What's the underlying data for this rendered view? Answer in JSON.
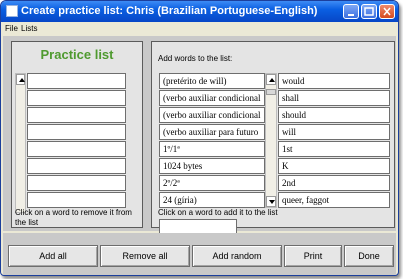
{
  "window": {
    "title": "Create practice list: Chris (Brazilian Portuguese-English)"
  },
  "menu": {
    "items": [
      "File",
      "Lists"
    ]
  },
  "practice": {
    "title": "Practice list",
    "items": [
      "",
      "",
      "",
      "",
      "",
      "",
      "",
      "",
      ""
    ],
    "hint": "Click on a word to remove it from the list"
  },
  "add": {
    "heading": "Add words to the list:",
    "rows": [
      {
        "source": "(pretérito de will)",
        "target": "would"
      },
      {
        "source": "(verbo auxiliar condicional",
        "target": "shall"
      },
      {
        "source": "(verbo auxiliar condicional",
        "target": "should"
      },
      {
        "source": "(verbo auxiliar para futuro",
        "target": "will"
      },
      {
        "source": "1º/1ª",
        "target": "1st"
      },
      {
        "source": "1024 bytes",
        "target": "K"
      },
      {
        "source": "2º/2ª",
        "target": "2nd"
      },
      {
        "source": "24 (gíria)",
        "target": "queer, faggot"
      }
    ],
    "hint": "Click on a word to add it to the list",
    "input_value": ""
  },
  "buttons": {
    "add_all": "Add all",
    "remove_all": "Remove all",
    "add_random": "Add random",
    "print": "Print",
    "done": "Done"
  },
  "colors": {
    "titlebar": "#0a5fe2",
    "practice_title": "#4f9a2f",
    "panel_bg": "#e4e4e4"
  }
}
